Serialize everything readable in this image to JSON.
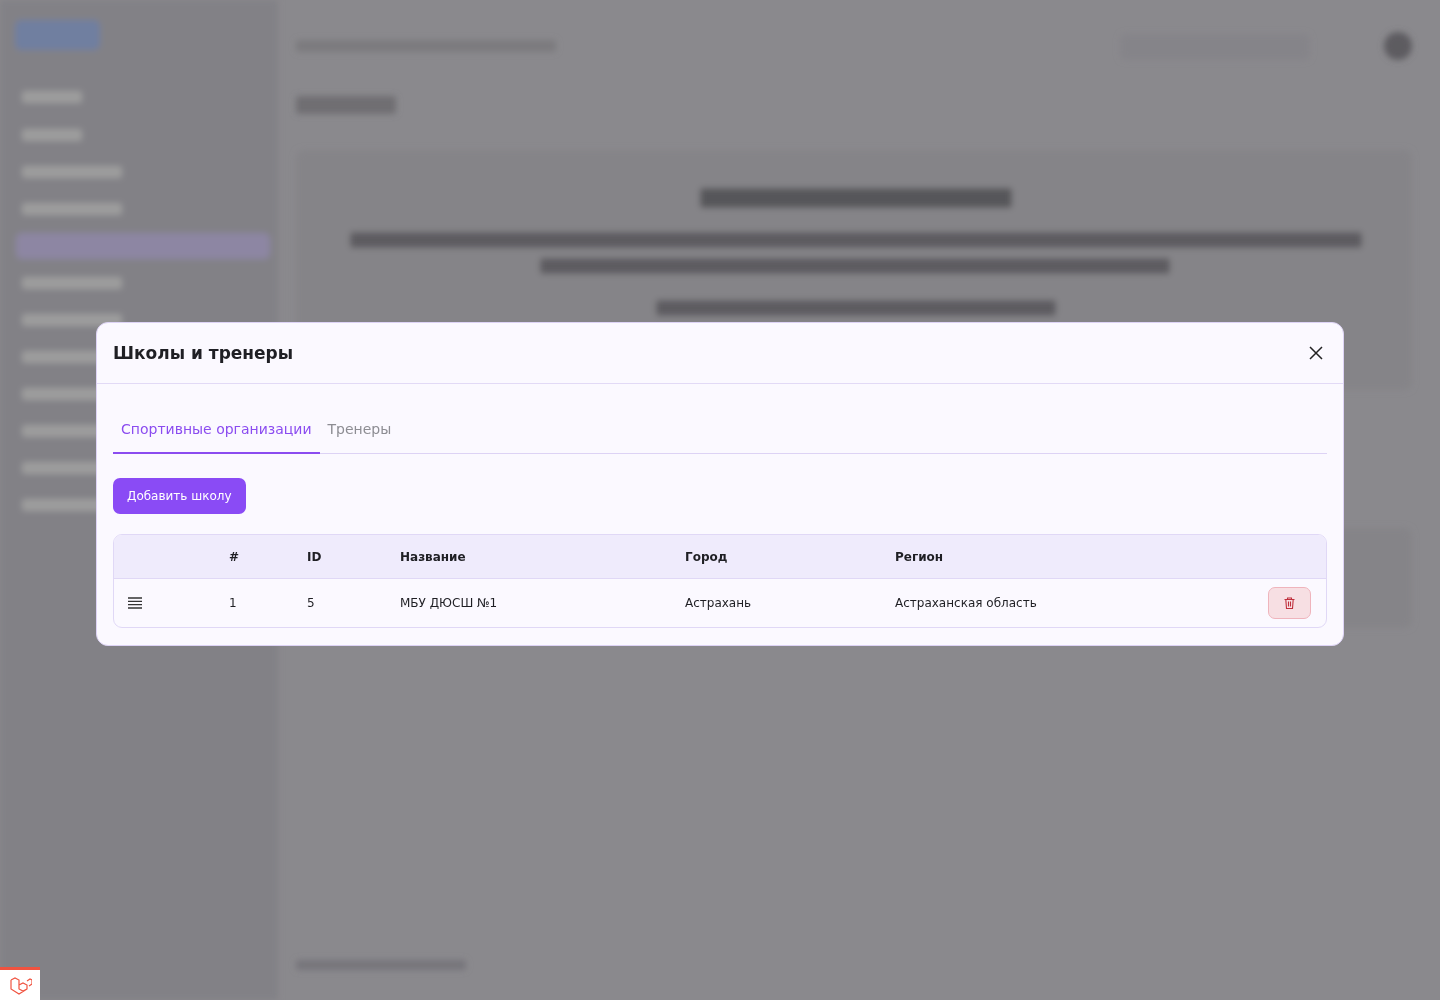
{
  "dialog": {
    "title": "Школы и тренеры",
    "tabs": [
      {
        "label": "Спортивные организации",
        "selected": true
      },
      {
        "label": "Тренеры",
        "selected": false
      }
    ],
    "add_button": "Добавить школу",
    "table": {
      "columns": [
        "#",
        "ID",
        "Название",
        "Город",
        "Регион"
      ],
      "rows": [
        {
          "number": "1",
          "id": "5",
          "name": "МБУ ДЮСШ №1",
          "city": "Астрахань",
          "region": "Астраханская область"
        }
      ]
    }
  }
}
